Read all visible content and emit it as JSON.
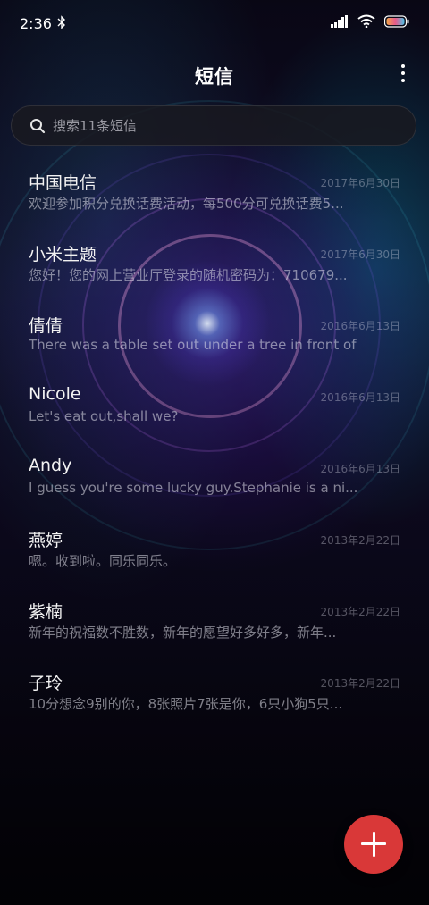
{
  "status": {
    "time": "2:36"
  },
  "header": {
    "title": "短信"
  },
  "search": {
    "placeholder": "搜索11条短信"
  },
  "conversations": [
    {
      "name": "中国电信",
      "date": "2017年6月30日",
      "preview": "欢迎参加积分兑换话费活动，每500分可兑换话费5..."
    },
    {
      "name": "小米主题",
      "date": "2017年6月30日",
      "preview": "您好！您的网上营业厅登录的随机密码为：710679..."
    },
    {
      "name": "倩倩",
      "date": "2016年6月13日",
      "preview": "There was a table set out under a tree in front of ..."
    },
    {
      "name": "Nicole",
      "date": "2016年6月13日",
      "preview": "Let's eat out,shall we?"
    },
    {
      "name": "Andy",
      "date": "2016年6月13日",
      "preview": "I guess you're some lucky guy.Stephanie is a ni..."
    },
    {
      "name": "燕婷",
      "date": "2013年2月22日",
      "preview": "嗯。收到啦。同乐同乐。"
    },
    {
      "name": "紫楠",
      "date": "2013年2月22日",
      "preview": "新年的祝福数不胜数，新年的愿望好多好多，新年..."
    },
    {
      "name": "子玲",
      "date": "2013年2月22日",
      "preview": "10分想念9别的你，8张照片7张是你，6只小狗5只..."
    }
  ],
  "colors": {
    "fab": "#d93838"
  }
}
